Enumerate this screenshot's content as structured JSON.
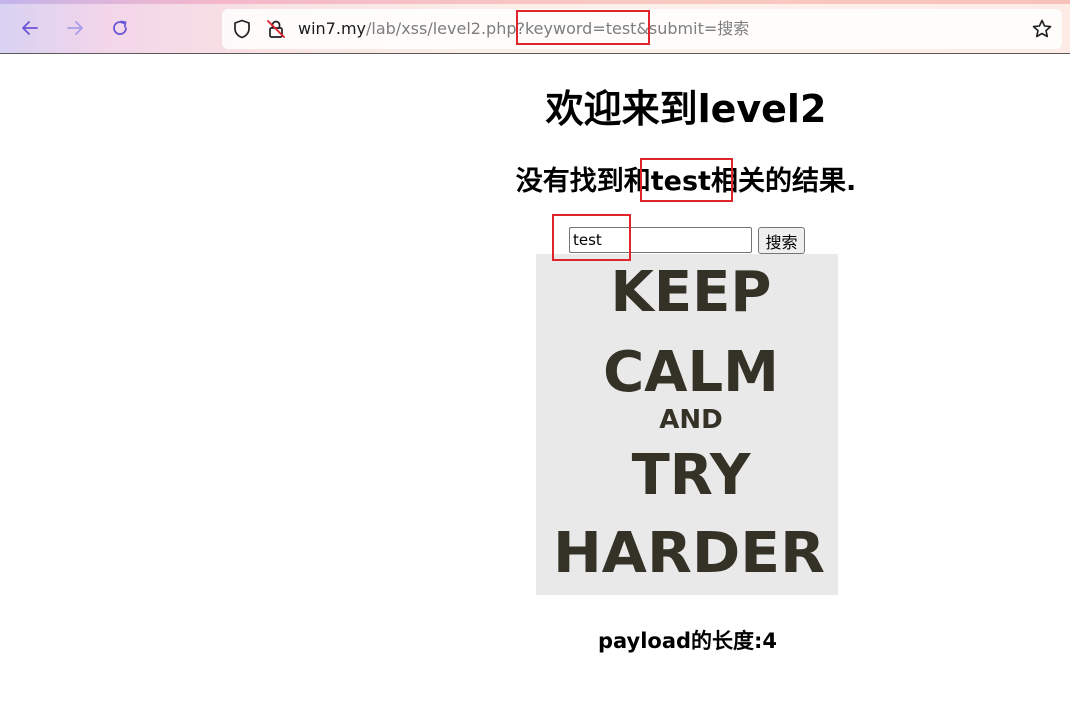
{
  "browser": {
    "url_host": "win7.my",
    "url_rest": "/lab/xss/level2.php?keyword=test&submit=搜索",
    "icons": {
      "back": "arrow-left-icon",
      "forward": "arrow-right-icon",
      "reload": "reload-icon",
      "tracking_protection": "shield-icon",
      "insecure_connection": "lock-slash-icon",
      "bookmark": "star-icon"
    }
  },
  "page": {
    "title": "欢迎来到level2",
    "result_text": "没有找到和test相关的结果.",
    "search": {
      "value": "test",
      "button_label": "搜索"
    },
    "poster": {
      "line1": "KEEP",
      "line2": "CALM",
      "line3": "AND",
      "line4": "TRY",
      "line5": "HARDER"
    },
    "payload_text": "payload的长度:4"
  },
  "colors": {
    "annotation_red": "#e0242b",
    "poster_bg": "#e9e9e9",
    "poster_text": "#343227"
  }
}
